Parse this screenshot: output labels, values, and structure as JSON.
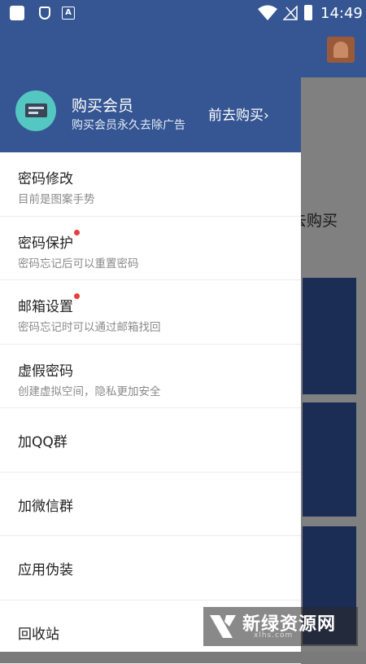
{
  "status_bar": {
    "time": "14:49",
    "icon3_letter": "A"
  },
  "background": {
    "buy_text": "去购买"
  },
  "header": {
    "vip_title": "购买会员",
    "vip_subtitle": "购买会员永久去除广告",
    "go_buy": "前去购买›"
  },
  "menu": [
    {
      "title": "密码修改",
      "subtitle": "目前是图案手势",
      "badge": false
    },
    {
      "title": "密码保护",
      "subtitle": "密码忘记后可以重置密码",
      "badge": true
    },
    {
      "title": "邮箱设置",
      "subtitle": "密码忘记时可以通过邮箱找回",
      "badge": true
    },
    {
      "title": "虚假密码",
      "subtitle": "创建虚拟空间，隐私更加安全",
      "badge": false
    },
    {
      "title": "加QQ群"
    },
    {
      "title": "加微信群"
    },
    {
      "title": "应用伪装"
    },
    {
      "title": "回收站"
    }
  ],
  "watermark": {
    "name": "新绿资源网",
    "url": "xlhs.com"
  },
  "colors": {
    "header": "#355692",
    "badge": "#ec3b3b",
    "vip_icon": "#55c7c2"
  }
}
